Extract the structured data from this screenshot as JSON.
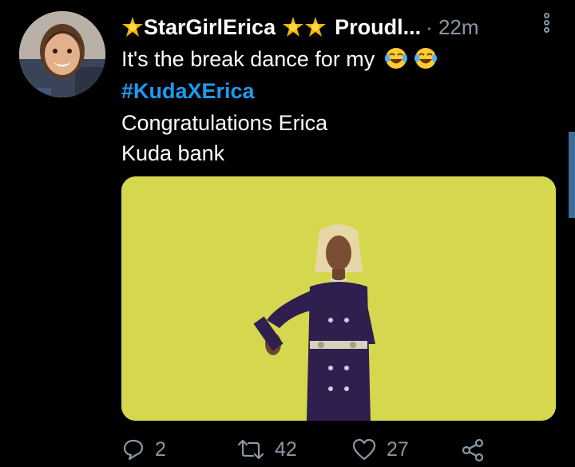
{
  "tweet": {
    "display_name": "StarGirlErica",
    "handle": "Proudl...",
    "time": "· 22m",
    "lines": {
      "line1": "It's the break dance for my",
      "hashtag": "#KudaXErica",
      "line3": "Congratulations Erica",
      "line4": "Kuda bank"
    }
  },
  "actions": {
    "replies": "2",
    "retweets": "42",
    "likes": "27"
  },
  "colors": {
    "background": "#000000",
    "hashtag": "#1d9bf0",
    "secondary_text": "#8b98a5",
    "media_backdrop": "#d7d94f"
  },
  "icons": [
    "star-icon",
    "laughing-emoji-icon",
    "more-options-icon",
    "reply-icon",
    "retweet-icon",
    "like-icon",
    "share-icon"
  ]
}
